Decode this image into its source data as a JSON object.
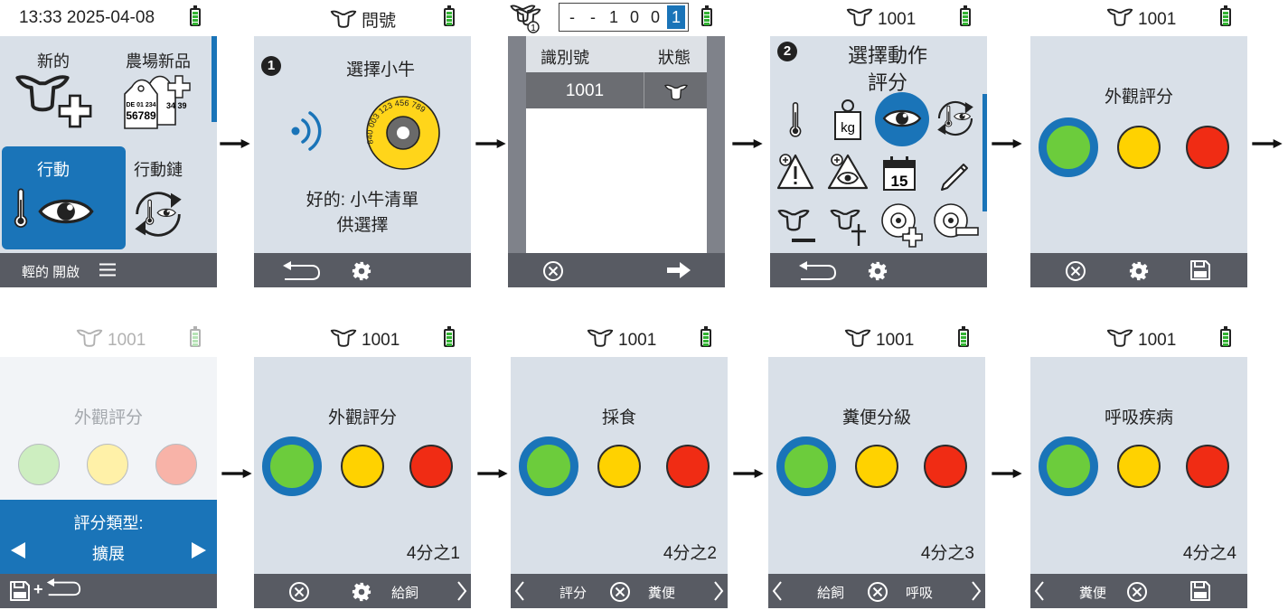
{
  "screen1": {
    "clock": "13:33 2025-04-08",
    "tiles": [
      {
        "label": "新的"
      },
      {
        "label": "農場新品",
        "tag_top": "DE 01 234",
        "tag_num": "56789",
        "tag_side": "34 39"
      },
      {
        "label": "行動"
      },
      {
        "label": "行動鏈"
      }
    ],
    "bottom_label": "輕的 開啟"
  },
  "screen2": {
    "status_title": "問號",
    "step": "1",
    "heading": "選擇小牛",
    "tag_text": "840 003 123 456 789",
    "message_line1": "好的: 小牛清單",
    "message_line2": "供選擇"
  },
  "screen3": {
    "herd_count": "1",
    "id_digits": [
      "-",
      "-",
      "1",
      "0",
      "0",
      "1"
    ],
    "columns": [
      "識別號",
      "狀態"
    ],
    "rows": [
      {
        "id": "1001"
      }
    ]
  },
  "screen4": {
    "cow_id": "1001",
    "step": "2",
    "heading_line1": "選擇動作",
    "heading_line2": "評分",
    "kg_label": "kg",
    "calendar_day": "15"
  },
  "screen5": {
    "cow_id": "1001",
    "title": "外觀評分"
  },
  "screen6": {
    "cow_id": "1001",
    "title": "外觀評分",
    "popup_title": "評分類型:",
    "popup_value": "擴展",
    "bottom_symbol": "+"
  },
  "screen7": {
    "cow_id": "1001",
    "title": "外觀評分",
    "counter": "4分之1",
    "next_label": "給飼"
  },
  "screen8": {
    "cow_id": "1001",
    "title": "採食",
    "counter": "4分之2",
    "prev_label": "評分",
    "next_label": "糞便"
  },
  "screen9": {
    "cow_id": "1001",
    "title": "糞便分級",
    "counter": "4分之3",
    "prev_label": "給飼",
    "next_label": "呼吸"
  },
  "screen10": {
    "cow_id": "1001",
    "title": "呼吸疾病",
    "counter": "4分之4",
    "prev_label": "糞便"
  },
  "colors": {
    "accent": "#1a74b8",
    "bar": "#585b63",
    "panel": "#d9e0e8",
    "green": "#6ccc3c",
    "yellow": "#ffd200",
    "red": "#f02c14"
  }
}
